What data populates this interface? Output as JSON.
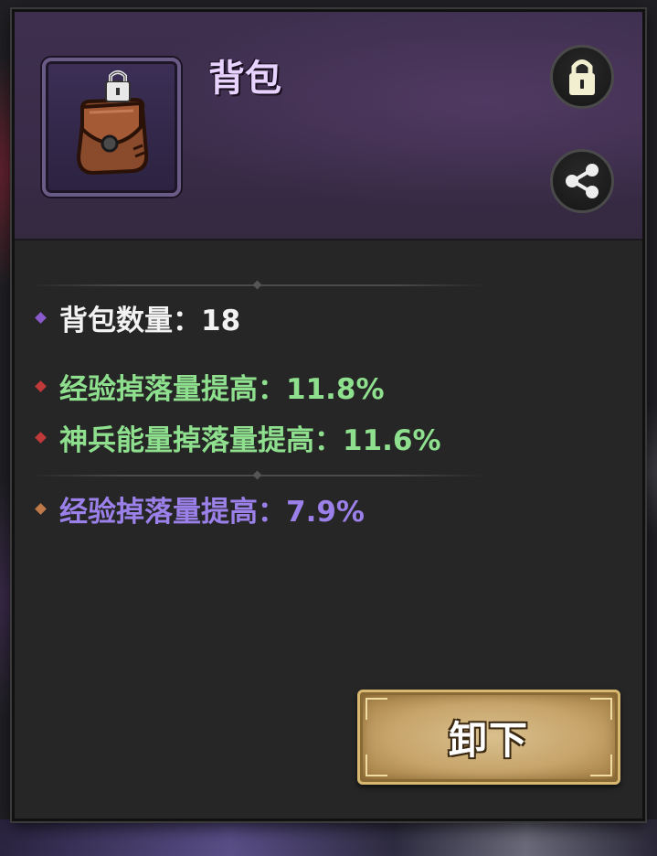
{
  "item": {
    "title": "背包",
    "icon": "leather-bag-icon",
    "locked": true
  },
  "actions": {
    "lock_icon": "lock-icon",
    "share_icon": "share-icon",
    "unequip_label": "卸下"
  },
  "stats": {
    "base": [
      {
        "text": "背包数量：18",
        "color": "#f2f2f2",
        "bullet": "#8a5acc"
      }
    ],
    "bonus": [
      {
        "text": "经验掉落量提高：11.8%",
        "color": "#8ee08e",
        "bullet": "#c03a3a"
      },
      {
        "text": "神兵能量掉落量提高：11.6%",
        "color": "#8ee08e",
        "bullet": "#c03a3a"
      }
    ],
    "extra": [
      {
        "text": "经验掉落量提高：7.9%",
        "color": "#9a80e8",
        "bullet": "#c07a4a"
      }
    ]
  },
  "colors": {
    "header_bg": "#3a2c49",
    "panel_bg": "#262626",
    "title": "#e8d2ff",
    "button_gold": "#c7a46a"
  }
}
